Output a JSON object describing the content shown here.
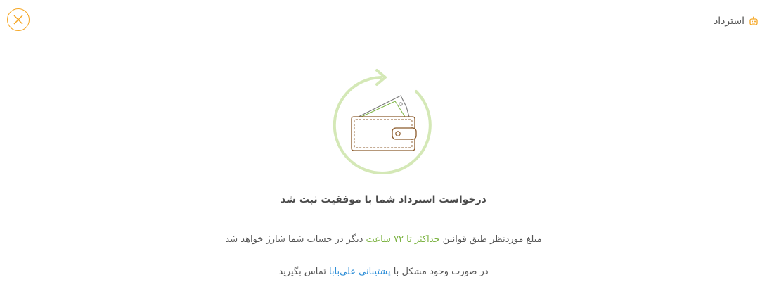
{
  "header": {
    "title": "استرداد",
    "title_icon": "robot-face-icon",
    "close_icon": "close-icon"
  },
  "colors": {
    "accent": "#f5a623",
    "success_green": "#7cb342",
    "link_blue": "#2f8fd8",
    "wallet_brown": "#8b5a2b",
    "ring_green": "#d4e8b6"
  },
  "illustration": {
    "icon": "wallet-refund-icon"
  },
  "message": {
    "headline": "درخواست استرداد شما با موفقیت ثبت شد",
    "line1_before": "مبلغ موردنظر طبق قوانین ",
    "line1_highlight": "حداکثر تا ۷۲ ساعت",
    "line1_after": " دیگر در حساب شما شارژ خواهد شد",
    "line2_before": "در صورت وجود مشکل با ",
    "line2_link": "پشتیبانی علی‌بابا",
    "line2_after": " تماس بگیرید"
  }
}
